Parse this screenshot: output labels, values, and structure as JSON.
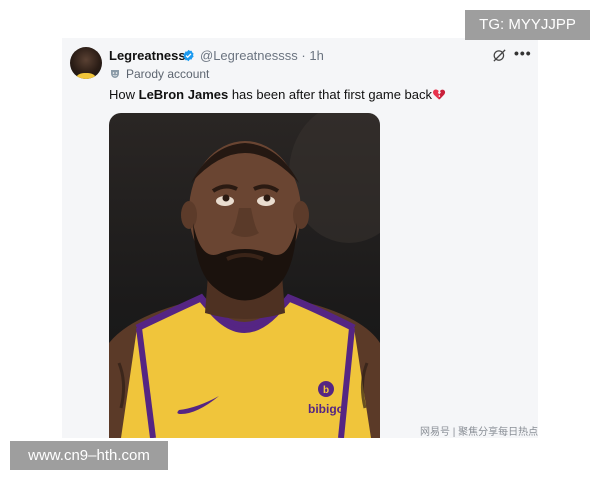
{
  "overlays": {
    "top_right_banner": "TG: MYYJJPP",
    "bottom_left_banner": "www.cn9–hth.com",
    "source_watermark": "网易号 | 聚焦分享每日热点"
  },
  "post": {
    "display_name": "Legreatness",
    "handle": "@Legreatnessss",
    "separator": "·",
    "time": "1h",
    "account_label": "Parody account",
    "text_before": "How ",
    "text_bold": "LeBron James",
    "text_after": " has been after that first game back",
    "emoji": "broken-heart-emoji",
    "jersey_sponsor": "bibigo",
    "verified_color": "#1d9bf0",
    "icons": {
      "verified": "verified-badge-icon",
      "grok": "grok-icon",
      "more": "more-options-icon",
      "parody": "parody-mask-icon"
    }
  },
  "colors": {
    "card_background": "#f5f6f8",
    "jersey_gold": "#f0c53b",
    "jersey_purple": "#552583",
    "banner_gray": "#9e9e9e"
  }
}
